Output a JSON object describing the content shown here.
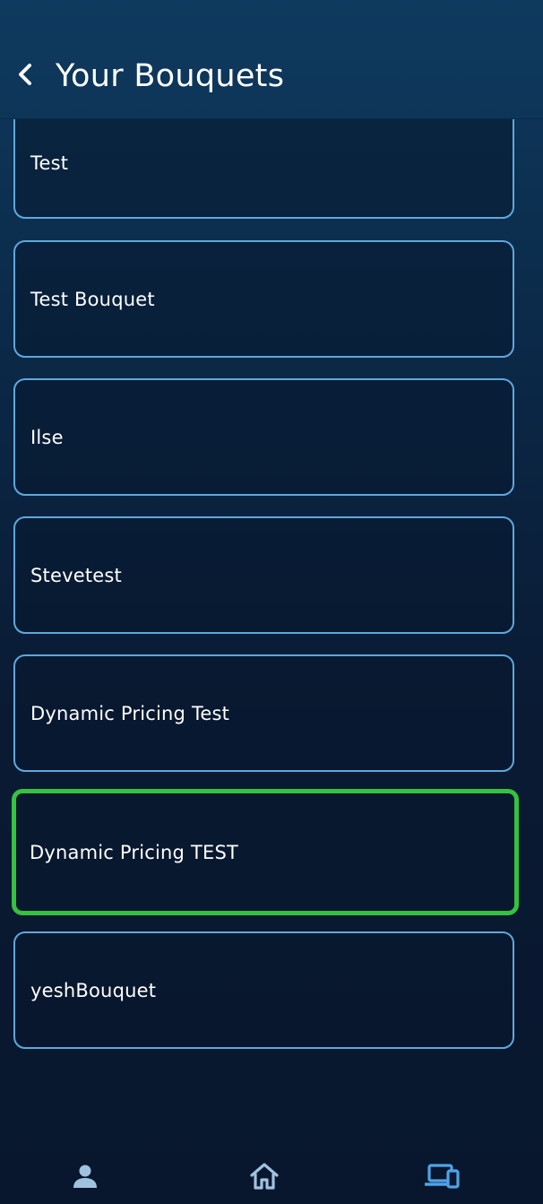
{
  "header": {
    "title": "Your Bouquets",
    "back_icon": "chevron-left-icon"
  },
  "bouquets": [
    {
      "name": "Test",
      "selected": false
    },
    {
      "name": "Test Bouquet",
      "selected": false
    },
    {
      "name": "Ilse",
      "selected": false
    },
    {
      "name": "Stevetest",
      "selected": false
    },
    {
      "name": "Dynamic Pricing Test",
      "selected": false
    },
    {
      "name": "Dynamic Pricing TEST",
      "selected": true
    },
    {
      "name": "yeshBouquet",
      "selected": false
    }
  ],
  "bottom_nav": {
    "items": [
      {
        "icon": "person-icon",
        "active": false
      },
      {
        "icon": "home-icon",
        "active": false
      },
      {
        "icon": "devices-icon",
        "active": true
      }
    ]
  },
  "colors": {
    "card_border": "#5ea8dc",
    "selected_border": "#34c23f",
    "nav_inactive": "#9fc2e0",
    "nav_active": "#4fa3e8"
  }
}
